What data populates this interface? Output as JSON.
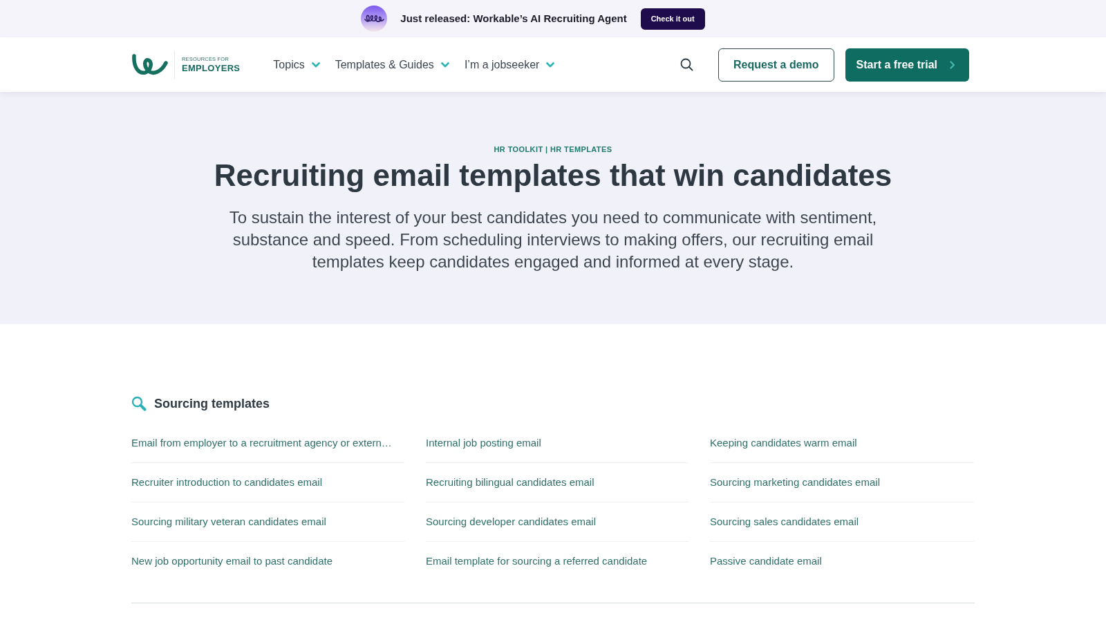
{
  "announcement": {
    "text": "Just released: Workable’s AI Recruiting Agent",
    "button": "Check it out"
  },
  "header": {
    "logo": {
      "line_1": "RESOURCES FOR",
      "line_2": "EMPLOYERS"
    },
    "nav": [
      {
        "label": "Topics"
      },
      {
        "label": "Templates & Guides"
      },
      {
        "label": "I’m a jobseeker"
      }
    ],
    "buttons": [
      {
        "label": "Request a demo",
        "kind": "outline"
      },
      {
        "label": "Start a free trial",
        "kind": "primary"
      }
    ]
  },
  "hero": {
    "eyebrow": "HR TOOLKIT | HR TEMPLATES",
    "title": "Recruiting email templates that win candidates",
    "intro": "To sustain the interest of your best candidates you need to communicate with sentiment, substance and speed. From scheduling interviews to making offers, our recruiting email templates keep candidates engaged and informed at every stage."
  },
  "section": {
    "title": "Sourcing templates",
    "columns": [
      [
        "Email from employer to a recruitment agency or extern…",
        "Recruiter introduction to candidates email",
        "Sourcing military veteran candidates email",
        "New job opportunity email to past candidate"
      ],
      [
        "Internal job posting email",
        "Recruiting bilingual candidates email",
        "Sourcing developer candidates email",
        "Email template for sourcing a referred candidate"
      ],
      [
        "Keeping candidates warm email",
        "Sourcing marketing candidates email",
        "Sourcing sales candidates email",
        "Passive candidate email"
      ]
    ]
  }
}
